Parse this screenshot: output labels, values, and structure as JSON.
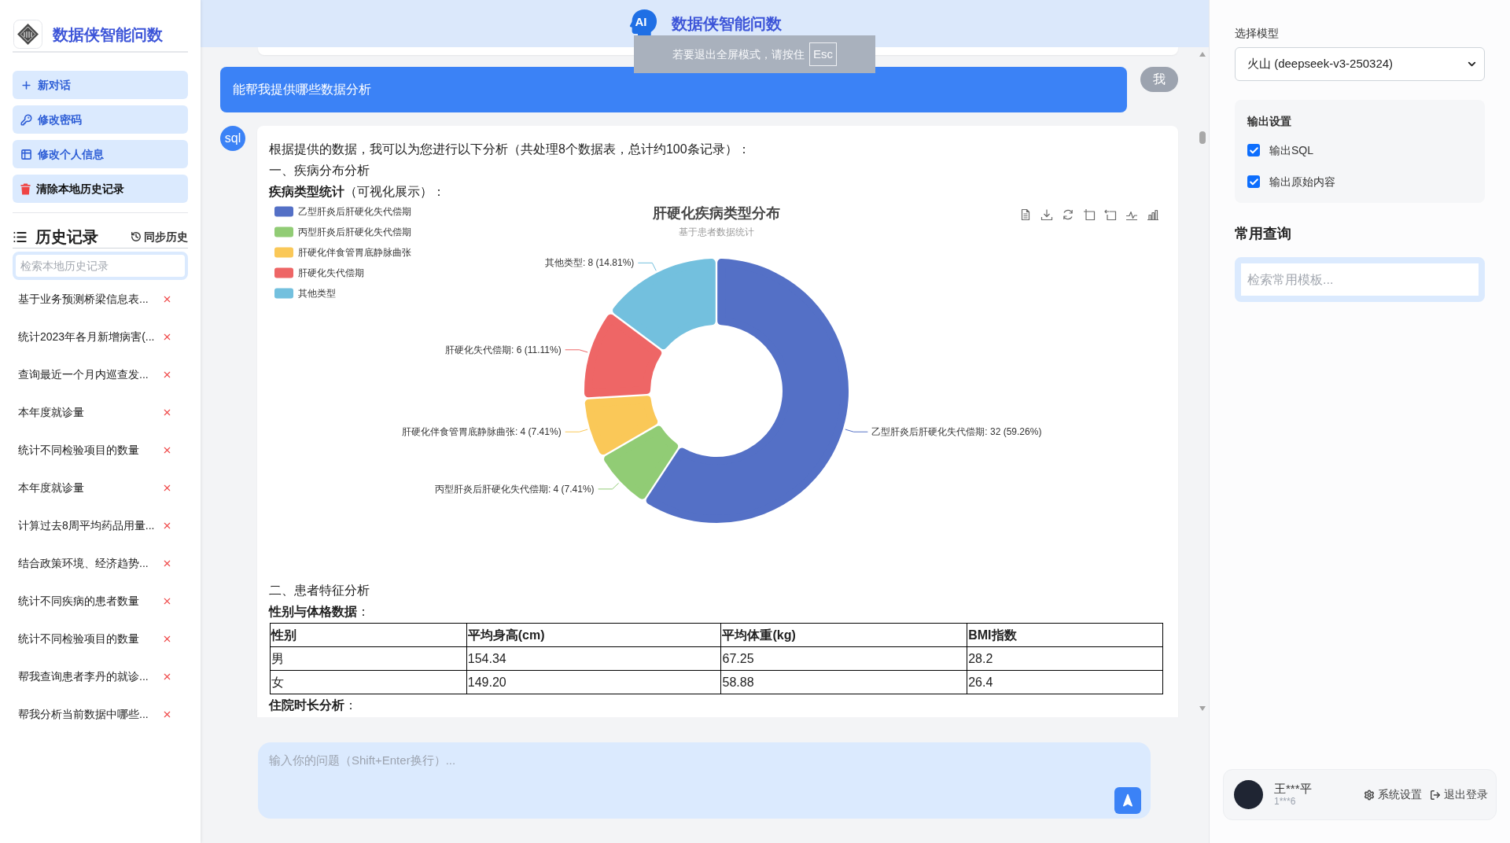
{
  "sidebar": {
    "title": "数据侠智能问数",
    "actions": [
      {
        "kind": "new",
        "label": "新对话"
      },
      {
        "kind": "password",
        "label": "修改密码"
      },
      {
        "kind": "profile",
        "label": "修改个人信息"
      },
      {
        "kind": "clear",
        "label": "清除本地历史记录"
      }
    ],
    "history": {
      "title": "历史记录",
      "sync_label": "同步历史",
      "search": {
        "placeholder": "检索本地历史记录"
      },
      "items": [
        {
          "label": "基于业务预测桥梁信息表..."
        },
        {
          "label": "统计2023年各月新增病害(..."
        },
        {
          "label": "查询最近一个月内巡查发..."
        },
        {
          "label": "本年度就诊量"
        },
        {
          "label": "统计不同检验项目的数量"
        },
        {
          "label": "本年度就诊量"
        },
        {
          "label": "计算过去8周平均药品用量..."
        },
        {
          "label": "结合政策环境、经济趋势..."
        },
        {
          "label": "统计不同疾病的患者数量"
        },
        {
          "label": "统计不同检验项目的数量"
        },
        {
          "label": "帮我查询患者李丹的就诊..."
        },
        {
          "label": "帮我分析当前数据中哪些..."
        }
      ]
    }
  },
  "header": {
    "logo_text": "AI",
    "title": "数据侠智能问数"
  },
  "fullscreen_notice": {
    "text": "若要退出全屏模式，请按住",
    "key": "Esc"
  },
  "conversation": {
    "user_message": {
      "text": "能帮我提供哪些数据分析",
      "avatar": "我"
    },
    "reply": {
      "avatar": "sql",
      "blocks": [
        {
          "kind": "paragraph",
          "text": "根据提供的数据，我可以为您进行以下分析（共处理8个数据表，总计约100条记录）："
        },
        {
          "kind": "paragraph",
          "text": "一、疾病分布分析"
        },
        {
          "kind": "paragraph",
          "text": "**疾病类型统计**（可视化展示）："
        },
        {
          "kind": "chart",
          "subtitle": "基于患者数据统计",
          "chart_data": {
            "type": "donut",
            "title": "肝硬化疾病类型分布",
            "categories": [
              "乙型肝炎后肝硬化失代偿期",
              "丙型肝炎后肝硬化失代偿期",
              "肝硬化伴食管胃底静脉曲张",
              "肝硬化失代偿期",
              "其他类型"
            ],
            "values": [
              32,
              4,
              4,
              6,
              8
            ],
            "colors": [
              "#5470c6",
              "#91cc75",
              "#fac858",
              "#ee6666",
              "#73c0de"
            ],
            "legend": true,
            "value_labels": [
              "乙型肝炎后肝硬化失代偿期: 32 (59.26%)",
              "丙型肝炎后肝硬化失代偿期: 4 (7.41%)",
              "肝硬化伴食管胃底静脉曲张: 4 (7.41%)",
              "肝硬化失代偿期: 6 (11.11%)",
              "其他类型: 8 (14.81%)"
            ]
          }
        },
        {
          "kind": "paragraph",
          "text": "二、患者特征分析"
        },
        {
          "kind": "paragraph",
          "text": "**性别与体格数据**："
        },
        {
          "kind": "table",
          "columns": [
            "性别",
            "平均身高(cm)",
            "平均体重(kg)",
            "BMI指数"
          ],
          "rows": [
            [
              "男",
              "154.34",
              "67.25",
              "28.2"
            ],
            [
              "女",
              "149.20",
              "58.88",
              "26.4"
            ]
          ]
        },
        {
          "kind": "paragraph",
          "text": "**住院时长分析**："
        }
      ]
    }
  },
  "composer": {
    "placeholder": "输入你的问题（Shift+Enter换行）..."
  },
  "right_panel": {
    "model": {
      "label": "选择模型",
      "value": "火山 (deepseek-v3-250324)"
    },
    "output_settings": {
      "title": "输出设置",
      "options": [
        {
          "label": "输出SQL",
          "checked": true
        },
        {
          "label": "输出原始内容",
          "checked": true
        }
      ]
    },
    "templates": {
      "title": "常用查询",
      "search": {
        "placeholder": "检索常用模板..."
      }
    },
    "user": {
      "name": "王***平",
      "account": "1***6",
      "actions": [
        {
          "kind": "settings",
          "label": "系统设置"
        },
        {
          "kind": "logout",
          "label": "退出登录"
        }
      ]
    }
  }
}
